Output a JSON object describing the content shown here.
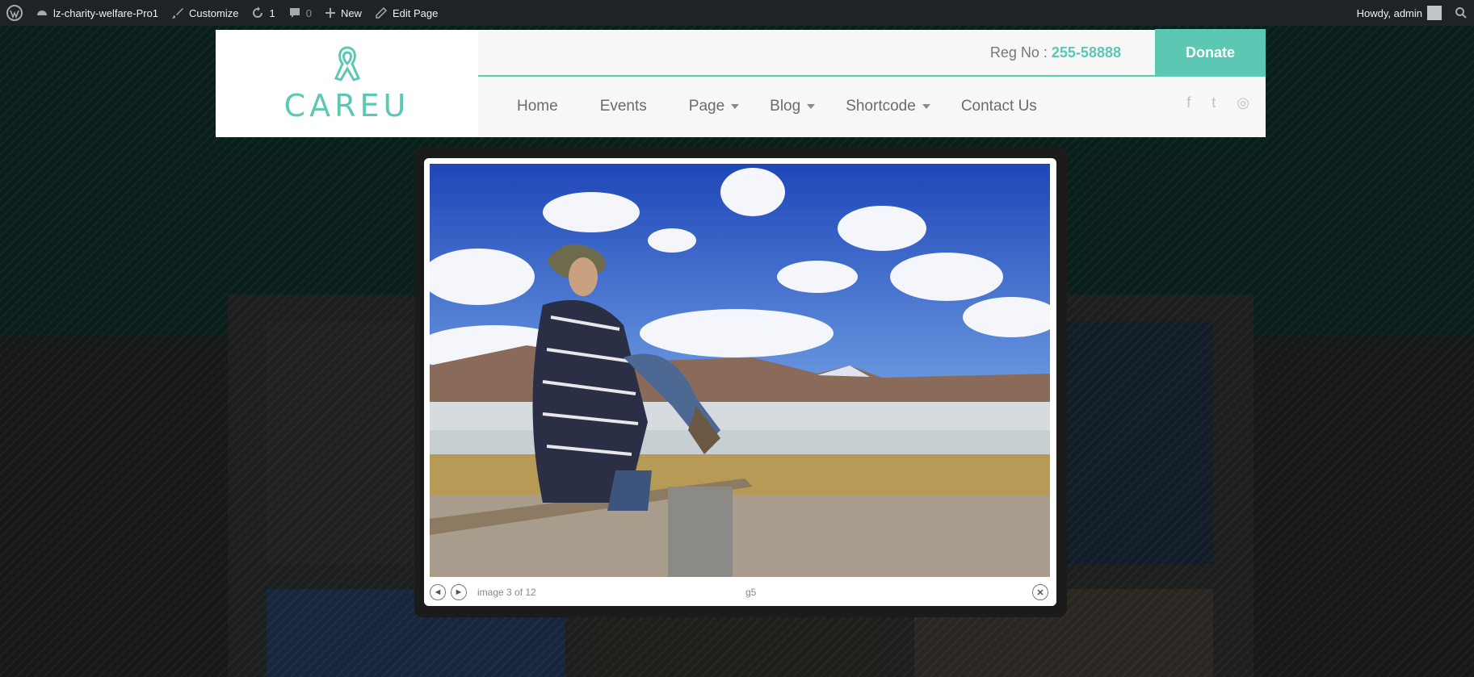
{
  "adminbar": {
    "site_name": "lz-charity-welfare-Pro1",
    "customize": "Customize",
    "updates_count": "1",
    "comments_count": "0",
    "new_label": "New",
    "edit_page": "Edit Page",
    "howdy": "Howdy, admin",
    "icons": [
      "wordpress-icon",
      "dashboard-icon",
      "brush-icon",
      "refresh-icon",
      "comment-icon",
      "plus-icon",
      "pencil-icon",
      "avatar",
      "search-icon"
    ]
  },
  "header": {
    "logo_text": "CAREU",
    "reg_label": "Reg No :",
    "reg_number": "255-58888",
    "donate_label": "Donate",
    "nav": [
      {
        "label": "Home",
        "has_dropdown": false
      },
      {
        "label": "Events",
        "has_dropdown": false
      },
      {
        "label": "Page",
        "has_dropdown": true
      },
      {
        "label": "Blog",
        "has_dropdown": true
      },
      {
        "label": "Shortcode",
        "has_dropdown": true
      },
      {
        "label": "Contact Us",
        "has_dropdown": false
      }
    ],
    "social": [
      {
        "icon": "facebook-icon",
        "glyph": "f"
      },
      {
        "icon": "twitter-icon",
        "glyph": "t"
      },
      {
        "icon": "instagram-icon",
        "glyph": "◎"
      }
    ]
  },
  "lightbox": {
    "counter": "image 3 of 12",
    "caption": "g5",
    "prev_glyph": "◄",
    "next_glyph": "►",
    "close_glyph": "✕"
  },
  "colors": {
    "accent": "#5cc7b2",
    "adminbar": "#1d2327"
  }
}
